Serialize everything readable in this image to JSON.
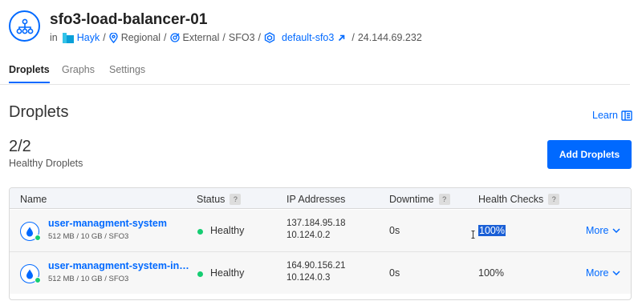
{
  "header": {
    "title": "sfo3-load-balancer-01",
    "in_label": "in",
    "project": "Hayk",
    "sep1": "/",
    "scope": "Regional",
    "sep2": "/",
    "type": "External",
    "sep3": "/",
    "region": "SFO3",
    "sep4": "/",
    "vpc": "default-sfo3",
    "sep5": "/",
    "ip": "24.144.69.232"
  },
  "tabs": [
    {
      "label": "Droplets",
      "active": true
    },
    {
      "label": "Graphs",
      "active": false
    },
    {
      "label": "Settings",
      "active": false
    }
  ],
  "section": {
    "title": "Droplets",
    "learn_label": "Learn",
    "count": "2/2",
    "count_label": "Healthy Droplets",
    "add_button": "Add Droplets"
  },
  "table": {
    "columns": {
      "name": "Name",
      "status": "Status",
      "ip": "IP Addresses",
      "downtime": "Downtime",
      "health_checks": "Health Checks",
      "help": "?"
    },
    "rows": [
      {
        "name": "user-managment-system",
        "spec": "512 MB / 10 GB / SFO3",
        "status": "Healthy",
        "ip_public": "137.184.95.18",
        "ip_private": "10.124.0.2",
        "downtime": "0s",
        "health_checks": "100%",
        "more": "More"
      },
      {
        "name": "user-managment-system-instance",
        "spec": "512 MB / 10 GB / SFO3",
        "status": "Healthy",
        "ip_public": "164.90.156.21",
        "ip_private": "10.124.0.3",
        "downtime": "0s",
        "health_checks": "100%",
        "more": "More"
      }
    ]
  },
  "colors": {
    "accent": "#0069ff",
    "healthy": "#15cd72"
  }
}
